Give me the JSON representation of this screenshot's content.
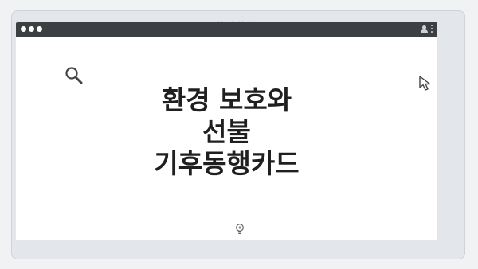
{
  "browser": {
    "window_dots": [
      "close",
      "minimize",
      "maximize"
    ],
    "icons": [
      "user-icon",
      "kebab-menu-icon"
    ]
  },
  "page": {
    "title": "환경 보호와\n선불\n기후동행카드",
    "icons": [
      "search-icon",
      "cursor-icon",
      "lightbulb-icon"
    ]
  },
  "colors": {
    "browser_bar": "#3c4043",
    "frame": "#e3e6ea",
    "content_bg": "#ffffff",
    "title_text": "#1f1f1f"
  }
}
